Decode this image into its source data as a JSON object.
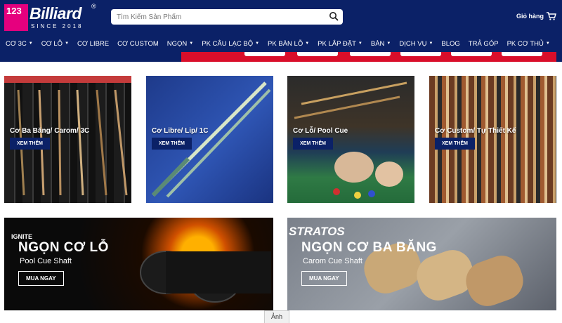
{
  "header": {
    "logo_number": "123",
    "logo_name": "Billiard",
    "logo_since": "SINCE 2018",
    "search_placeholder": "Tìm Kiếm Sản Phẩm",
    "cart_label": "Giỏ hàng"
  },
  "nav": [
    {
      "label": "CƠ 3C",
      "has_menu": true
    },
    {
      "label": "CƠ LỖ",
      "has_menu": true
    },
    {
      "label": "CƠ LIBRE",
      "has_menu": false
    },
    {
      "label": "CƠ CUSTOM",
      "has_menu": false
    },
    {
      "label": "NGỌN",
      "has_menu": true
    },
    {
      "label": "PK CÂU LẠC BỘ",
      "has_menu": true
    },
    {
      "label": "PK BÀN LỖ",
      "has_menu": true
    },
    {
      "label": "PK LẮP ĐẶT",
      "has_menu": true
    },
    {
      "label": "BÀN",
      "has_menu": true
    },
    {
      "label": "DỊCH VỤ",
      "has_menu": true
    },
    {
      "label": "BLOG",
      "has_menu": false
    },
    {
      "label": "TRẢ GÓP",
      "has_menu": false
    },
    {
      "label": "PK CƠ THỦ",
      "has_menu": true
    }
  ],
  "categories": [
    {
      "label": "Cơ Ba Băng/ Carom/ 3C",
      "button": "XEM THÊM"
    },
    {
      "label": "Cơ Libre/ Lip/ 1C",
      "button": "XEM THÊM"
    },
    {
      "label": "Cơ Lỗ/ Pool Cue",
      "button": "XEM THÊM"
    },
    {
      "label": "Cơ Custom/ Tự Thiết Kế",
      "button": "XEM THÊM"
    }
  ],
  "banners": [
    {
      "brand": "IGNITE",
      "title": "NGỌN CƠ LỖ",
      "subtitle": "Pool Cue Shaft",
      "button": "MUA NGAY"
    },
    {
      "brand": "STRATOS",
      "title": "NGỌN CƠ BA BĂNG",
      "subtitle": "Carom Cue Shaft",
      "button": "MUA NGAY"
    }
  ],
  "caption": "Ảnh",
  "colors": {
    "nav_bg": "#0b2167",
    "accent": "#e6007e",
    "strip": "#d90e2a"
  }
}
